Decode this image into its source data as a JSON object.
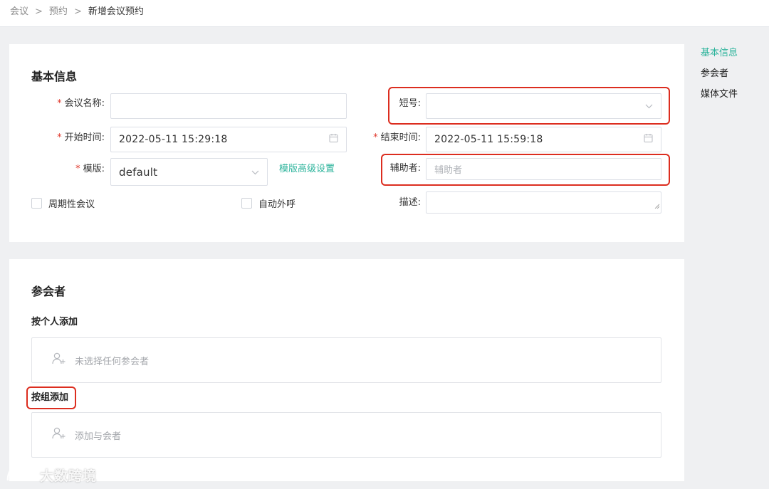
{
  "breadcrumb": {
    "items": [
      "会议",
      "预约",
      "新增会议预约"
    ],
    "separator": ">"
  },
  "anchor_nav": {
    "items": [
      {
        "label": "基本信息",
        "active": true
      },
      {
        "label": "参会者",
        "active": false
      },
      {
        "label": "媒体文件",
        "active": false
      }
    ]
  },
  "basic_info": {
    "title": "基本信息",
    "meeting_name": {
      "label": "会议名称:",
      "value": ""
    },
    "short_number": {
      "label": "短号:",
      "value": ""
    },
    "start_time": {
      "label": "开始时间:",
      "value": "2022-05-11 15:29:18"
    },
    "end_time": {
      "label": "结束时间:",
      "value": "2022-05-11 15:59:18"
    },
    "template": {
      "label": "模版:",
      "value": "default",
      "advanced_link": "模版高级设置"
    },
    "assistant": {
      "label": "辅助者:",
      "placeholder": "辅助者"
    },
    "recurring": {
      "label": "周期性会议",
      "checked": false
    },
    "auto_call": {
      "label": "自动外呼",
      "checked": false
    },
    "description": {
      "label": "描述:",
      "value": ""
    },
    "required_mark": "*"
  },
  "participants": {
    "title": "参会者",
    "by_person": {
      "label": "按个人添加",
      "empty_text": "未选择任何参会者"
    },
    "by_group": {
      "label": "按组添加",
      "empty_text": "添加与会者"
    }
  },
  "watermark": {
    "text": "大数跨境"
  },
  "colors": {
    "accent": "#2bb39b",
    "required": "#e0372b",
    "highlight": "#dc2d1f",
    "background": "#eff0f2"
  }
}
